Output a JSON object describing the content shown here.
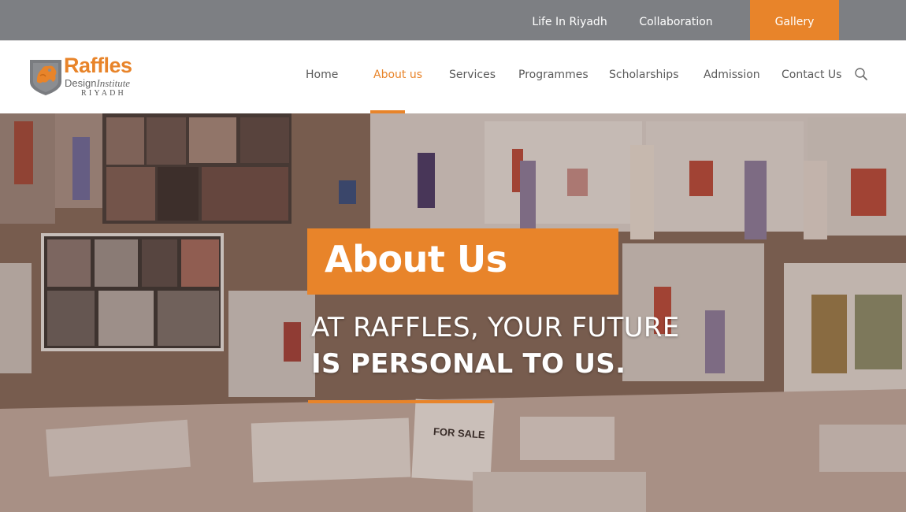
{
  "topbar": {
    "items": [
      {
        "label": "Life In Riyadh"
      },
      {
        "label": "Collaboration"
      },
      {
        "label": "Gallery"
      }
    ]
  },
  "logo": {
    "word": "Raffles",
    "sub_main": "Design",
    "sub_italic": "Institute",
    "city": "RIYADH"
  },
  "nav": {
    "items": [
      {
        "label": "Home"
      },
      {
        "label": "About us",
        "active": true
      },
      {
        "label": "Services"
      },
      {
        "label": "Programmes"
      },
      {
        "label": "Scholarships"
      },
      {
        "label": "Admission"
      },
      {
        "label": "Contact Us"
      }
    ],
    "search_icon": "search-icon"
  },
  "hero": {
    "title": "About Us",
    "tagline_line1": "AT RAFFLES, YOUR FUTURE",
    "tagline_line2": "IS PERSONAL TO US.",
    "sign_text": "FOR SALE"
  },
  "colors": {
    "accent": "#e8842a",
    "topbar": "#7d7f83",
    "nav_text": "#5a5a5a"
  }
}
